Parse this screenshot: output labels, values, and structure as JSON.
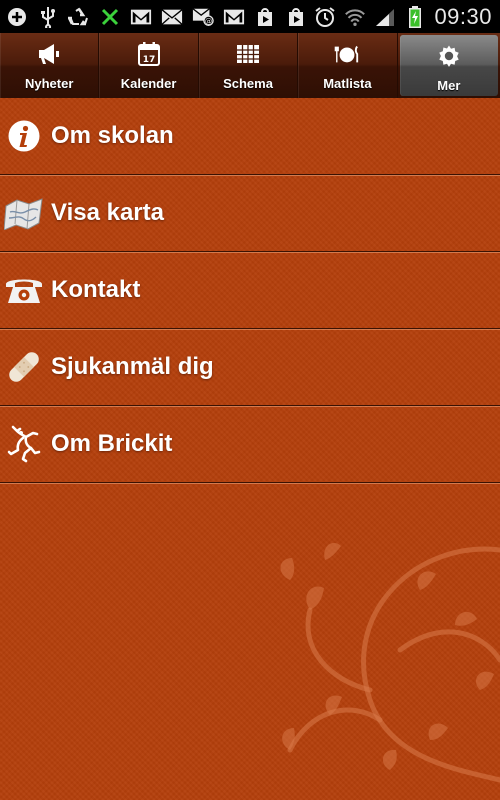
{
  "status_bar": {
    "time": "09:30",
    "left_icons": [
      "add-icon",
      "usb-icon",
      "recycle-icon",
      "bug-icon",
      "gmail-icon",
      "mail-icon",
      "email-at-icon",
      "gmail-icon",
      "play-store-icon",
      "play-store-icon"
    ],
    "right_icons": [
      "alarm-icon",
      "wifi-icon",
      "signal-icon",
      "battery-charging-icon"
    ]
  },
  "tabs": [
    {
      "label": "Nyheter",
      "icon": "megaphone-icon",
      "active": false
    },
    {
      "label": "Kalender",
      "icon": "calendar-icon",
      "active": false,
      "icon_text": "17"
    },
    {
      "label": "Schema",
      "icon": "schedule-grid-icon",
      "active": false
    },
    {
      "label": "Matlista",
      "icon": "food-plate-icon",
      "active": false
    },
    {
      "label": "Mer",
      "icon": "gear-icon",
      "active": true
    }
  ],
  "menu": [
    {
      "label": "Om skolan",
      "icon": "info-icon"
    },
    {
      "label": "Visa karta",
      "icon": "map-icon"
    },
    {
      "label": "Kontakt",
      "icon": "telephone-icon"
    },
    {
      "label": "Sjukanmäl dig",
      "icon": "bandage-icon"
    },
    {
      "label": "Om Brickit",
      "icon": "frog-icon"
    }
  ],
  "colors": {
    "background": "#b43f0b",
    "tabbar": "#4a1b0a",
    "active_tab": "#5c5c5c",
    "text": "#ffffff"
  }
}
